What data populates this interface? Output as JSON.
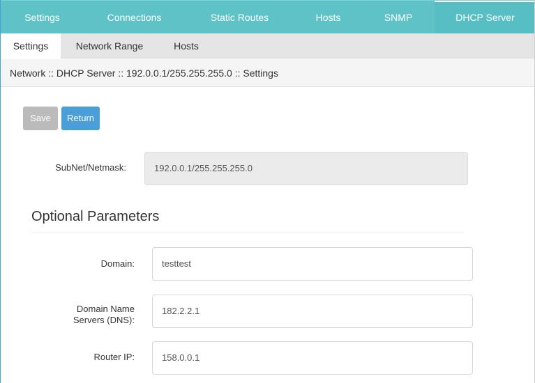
{
  "top_tabs": [
    {
      "label": "Settings"
    },
    {
      "label": "Connections"
    },
    {
      "label": "Static Routes"
    },
    {
      "label": "Hosts"
    },
    {
      "label": "SNMP"
    },
    {
      "label": "DHCP Server",
      "active": true
    }
  ],
  "sub_tabs": [
    {
      "label": "Settings",
      "active": true
    },
    {
      "label": "Network Range"
    },
    {
      "label": "Hosts"
    }
  ],
  "breadcrumb": "Network :: DHCP Server :: 192.0.0.1/255.255.255.0 :: Settings",
  "buttons": {
    "save": "Save",
    "return": "Return"
  },
  "subnet": {
    "label": "SubNet/Netmask:",
    "value": "192.0.0.1/255.255.255.0"
  },
  "optional": {
    "title": "Optional Parameters",
    "domain": {
      "label": "Domain:",
      "value": "testtest"
    },
    "dns": {
      "label_line1": "Domain Name",
      "label_line2": "Servers (DNS):",
      "value": "182.2.2.1"
    },
    "router": {
      "label": "Router IP:",
      "value": "158.0.0.1"
    }
  },
  "colors": {
    "top_nav": "#5ec2c6",
    "primary_button": "#4a9fd8",
    "disabled_button": "#bbbbbb"
  }
}
